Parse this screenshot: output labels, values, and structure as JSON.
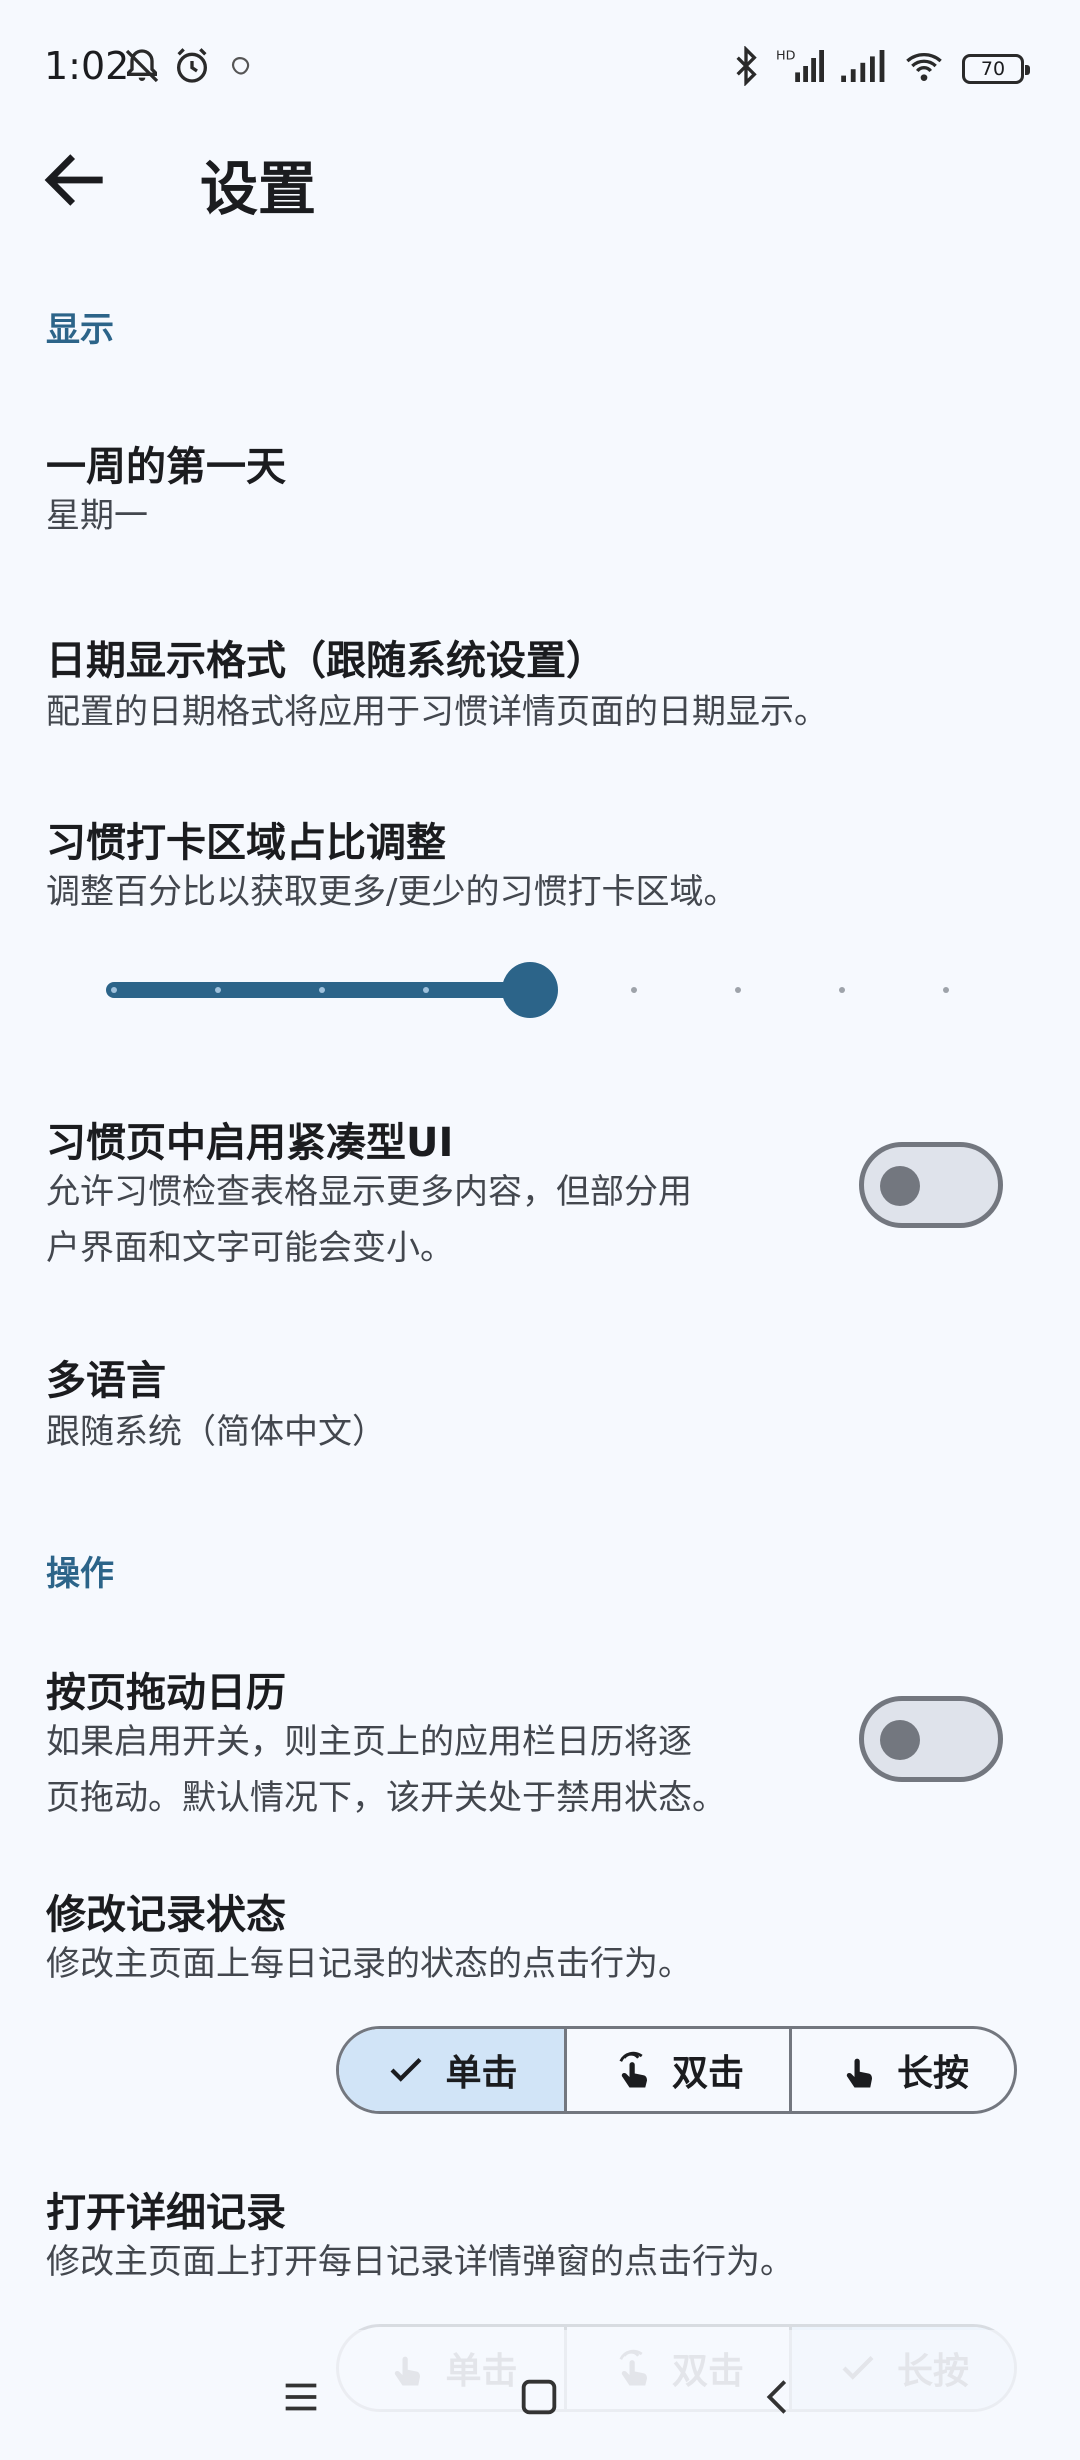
{
  "status_bar": {
    "time": "1:02",
    "battery": "70",
    "icons": [
      "mute-icon",
      "alarm-icon",
      "notification-icon",
      "bluetooth-icon",
      "hd-signal-icon",
      "signal-icon",
      "wifi-icon",
      "battery-icon"
    ]
  },
  "app_bar": {
    "title": "设置",
    "back_icon": "arrow-back-icon"
  },
  "sections": {
    "display": {
      "header": "显示",
      "first_day": {
        "title": "一周的第一天",
        "value": "星期一"
      },
      "date_format": {
        "title": "日期显示格式（跟随系统设置）",
        "subtitle": "配置的日期格式将应用于习惯详情页面的日期显示。"
      },
      "checkin_area": {
        "title": "习惯打卡区域占比调整",
        "subtitle": "调整百分比以获取更多/更少的习惯打卡区域。",
        "slider_value": 0.5,
        "slider_steps": 9
      },
      "compact_ui": {
        "title": "习惯页中启用紧凑型UI",
        "subtitle_line1": "允许习惯检查表格显示更多内容，但部分用",
        "subtitle_line2": "户界面和文字可能会变小。",
        "enabled": false
      },
      "language": {
        "title": "多语言",
        "value": "跟随系统（简体中文）"
      }
    },
    "operation": {
      "header": "操作",
      "page_drag": {
        "title": "按页拖动日历",
        "subtitle_line1": "如果启用开关，则主页上的应用栏日历将逐",
        "subtitle_line2": "页拖动。默认情况下，该开关处于禁用状态。",
        "enabled": false
      },
      "modify_status": {
        "title": "修改记录状态",
        "subtitle": "修改主页面上每日记录的状态的点击行为。",
        "options": [
          "单击",
          "双击",
          "长按"
        ],
        "selected": "单击"
      },
      "open_detail": {
        "title": "打开详细记录",
        "subtitle": "修改主页面上打开每日记录详情弹窗的点击行为。",
        "options": [
          "单击",
          "双击",
          "长按"
        ],
        "selected": "长按"
      }
    }
  },
  "colors": {
    "background": "#f6f9fe",
    "accent": "#2c6489",
    "selected_segment": "#d1e4f7",
    "outline": "#73777f"
  }
}
